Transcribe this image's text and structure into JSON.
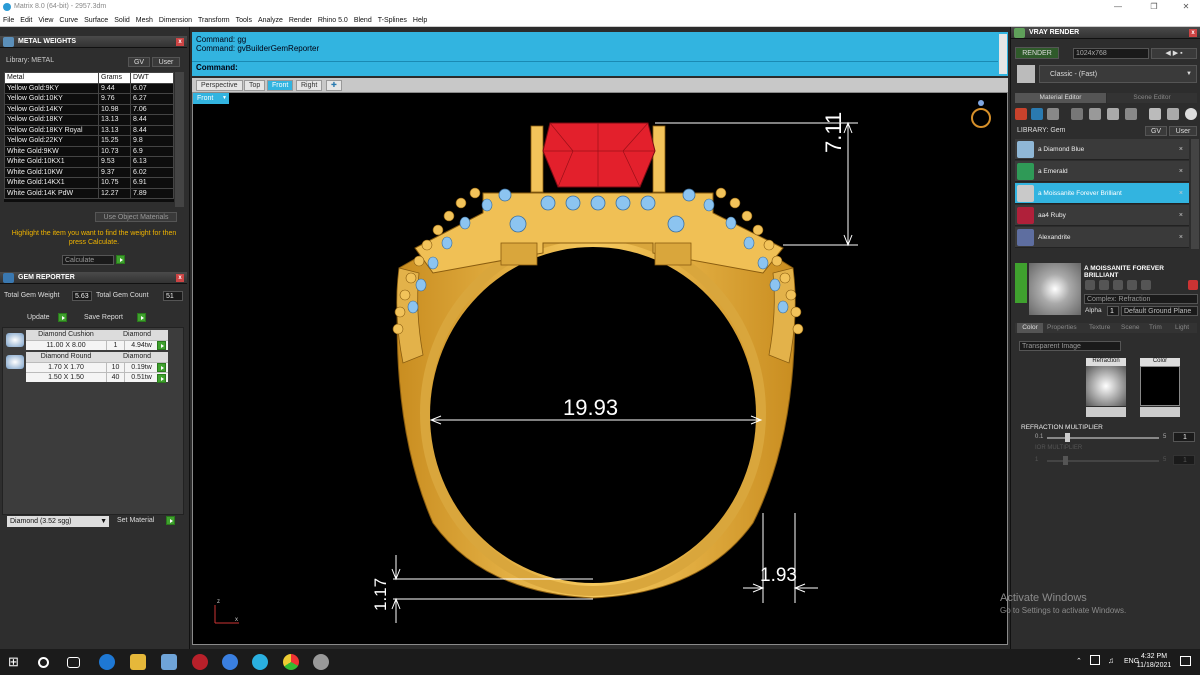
{
  "window": {
    "title": "Matrix 8.0 (64-bit) - 2957.3dm"
  },
  "menu": [
    "File",
    "Edit",
    "View",
    "Curve",
    "Surface",
    "Solid",
    "Mesh",
    "Dimension",
    "Transform",
    "Tools",
    "Analyze",
    "Render",
    "Rhino 5.0",
    "Blend",
    "T-Splines",
    "Help"
  ],
  "metal_weights": {
    "title": "METAL WEIGHTS",
    "library_label": "Library: METAL",
    "gv_label": "GV",
    "user_label": "User",
    "columns": [
      "Metal",
      "Grams",
      "DWT"
    ],
    "rows": [
      [
        "Yellow Gold:9KY",
        "9.44",
        "6.07"
      ],
      [
        "Yellow Gold:10KY",
        "9.76",
        "6.27"
      ],
      [
        "Yellow Gold:14KY",
        "10.98",
        "7.06"
      ],
      [
        "Yellow Gold:18KY",
        "13.13",
        "8.44"
      ],
      [
        "Yellow Gold:18KY Royal",
        "13.13",
        "8.44"
      ],
      [
        "Yellow Gold:22KY",
        "15.25",
        "9.8"
      ],
      [
        "White Gold:9KW",
        "10.73",
        "6.9"
      ],
      [
        "White Gold:10KX1",
        "9.53",
        "6.13"
      ],
      [
        "White Gold:10KW",
        "9.37",
        "6.02"
      ],
      [
        "White Gold:14KX1",
        "10.75",
        "6.91"
      ],
      [
        "White Gold:14K PdW",
        "12.27",
        "7.89"
      ]
    ],
    "use_object_materials": "Use Object Materials",
    "hint": "Highlight the item you want to find the weight for then press Calculate.",
    "calculate": "Calculate"
  },
  "gem_reporter": {
    "title": "GEM REPORTER",
    "total_weight_label": "Total Gem Weight",
    "total_weight": "5.63",
    "total_count_label": "Total Gem Count",
    "total_count": "51",
    "update": "Update",
    "save_report": "Save Report",
    "groups": [
      {
        "name": "Diamond Cushion",
        "material": "Diamond",
        "rows": [
          [
            "11.00 X 8.00",
            "1",
            "4.94tw"
          ]
        ]
      },
      {
        "name": "Diamond Round",
        "material": "Diamond",
        "rows": [
          [
            "1.70 X 1.70",
            "10",
            "0.19tw"
          ],
          [
            "1.50 X 1.50",
            "40",
            "0.51tw"
          ]
        ]
      }
    ],
    "material_select": "Diamond    (3.52 sgg)",
    "set_material": "Set Material"
  },
  "command": {
    "lines": [
      "Command: gg",
      "Command: gvBuilderGemReporter"
    ],
    "prompt": "Command:"
  },
  "viewport": {
    "tabs": [
      "Perspective",
      "Top",
      "Front",
      "Right"
    ],
    "active_tab": "Front",
    "view_label": "Front",
    "dimensions": {
      "height": "7.11",
      "width": "19.93",
      "shank_height": "1.17",
      "shank_width": "1.93"
    },
    "axis": {
      "z": "z",
      "x": "x"
    }
  },
  "vray": {
    "title": "VRAY RENDER",
    "render_label": "RENDER",
    "resolution": "1024x768",
    "style": "Classic - (Fast)",
    "tabs": [
      "Material Editor",
      "Scene Editor"
    ],
    "library_label": "LIBRARY: Gem",
    "gv_label": "GV",
    "user_label": "User",
    "materials": [
      {
        "name": "a Diamond Blue",
        "color": "#8fb7d6"
      },
      {
        "name": "a Emerald",
        "color": "#2f9a57"
      },
      {
        "name": "a Moissanite Forever Brilliant",
        "color": "#c9c9c9"
      },
      {
        "name": "aa4 Ruby",
        "color": "#b0203a"
      },
      {
        "name": "Alexandrite",
        "color": "#5e6ea0"
      }
    ],
    "selected_material": "A MOISSANITE FOREVER BRILLIANT",
    "complex_label": "Complex: Refraction",
    "alpha_label": "Alpha",
    "alpha_value": "1",
    "ground_plane": "Default Ground Plane",
    "prop_tabs": [
      "Color",
      "Properties",
      "Texture",
      "Scene",
      "Trim",
      "Light"
    ],
    "transparent_image": "Transparent Image",
    "refraction_label": "Refraction",
    "color_label": "Color",
    "refraction_multiplier": "REFRACTION MULTIPLIER",
    "slider_min": "0.1",
    "slider_max": "5",
    "slider_value": "1",
    "slider2_label": "IOR MULTIPLIER",
    "slider2_min": "1",
    "slider2_max": "5",
    "slider2_value": "1"
  },
  "watermark": {
    "line1": "Activate Windows",
    "line2": "Go to Settings to activate Windows."
  },
  "taskbar": {
    "time": "4:32 PM",
    "date": "11/18/2021",
    "lang": "ENG"
  },
  "colors": {
    "accent_cyan": "#32b4e0",
    "gold": "#f2c35a",
    "ruby": "#e3202c",
    "gem_blue": "#8cc4f0"
  }
}
